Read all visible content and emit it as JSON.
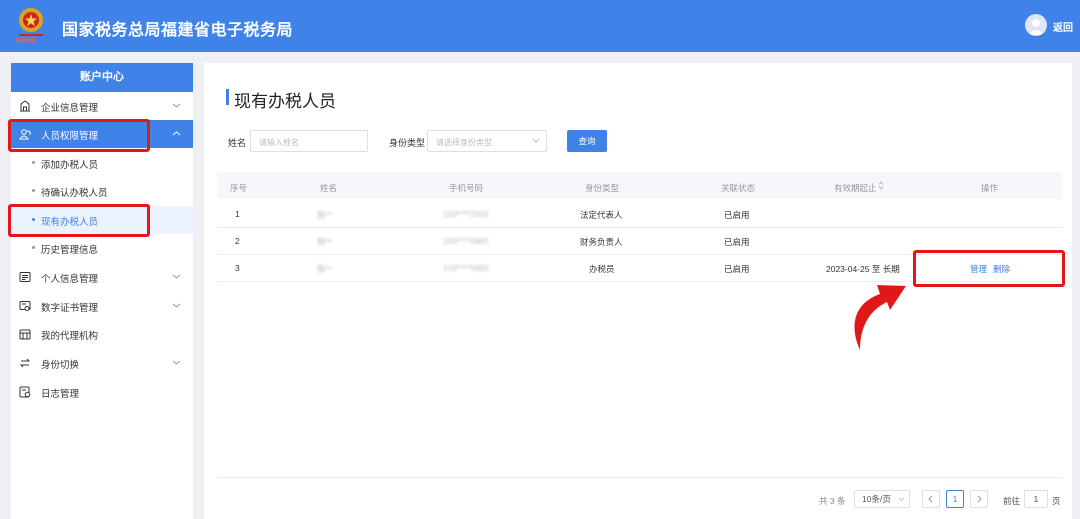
{
  "header": {
    "title": "国家税务总局福建省电子税务局",
    "back_label": "返回",
    "emblem_caption": "中国税务"
  },
  "sidebar": {
    "title": "账户中心",
    "items": [
      {
        "label": "企业信息管理",
        "icon": "building-icon",
        "expandable": true
      },
      {
        "label": "人员权限管理",
        "icon": "users-icon",
        "expandable": true,
        "expanded": true
      },
      {
        "label": "个人信息管理",
        "icon": "profile-card-icon",
        "expandable": true
      },
      {
        "label": "数字证书管理",
        "icon": "certificate-icon",
        "expandable": true
      },
      {
        "label": "我的代理机构",
        "icon": "agency-icon",
        "expandable": false
      },
      {
        "label": "身份切换",
        "icon": "switch-icon",
        "expandable": true
      },
      {
        "label": "日志管理",
        "icon": "log-icon",
        "expandable": false
      }
    ],
    "sub_items": [
      {
        "label": "添加办税人员"
      },
      {
        "label": "待确认办税人员"
      },
      {
        "label": "现有办税人员",
        "selected": true
      },
      {
        "label": "历史管理信息"
      }
    ]
  },
  "page": {
    "title": "现有办税人员"
  },
  "filters": {
    "name_label": "姓名",
    "name_placeholder": "请输入姓名",
    "id_type_label": "身份类型",
    "id_type_placeholder": "请选择身份类型",
    "query_label": "查询"
  },
  "table": {
    "headers": [
      "序号",
      "姓名",
      "手机号码",
      "身份类型",
      "关联状态",
      "有效期起止",
      "操作"
    ],
    "rows": [
      {
        "no": "1",
        "name": "陈**",
        "phone": "159****2601",
        "type": "法定代表人",
        "status": "已启用",
        "validity": ""
      },
      {
        "no": "2",
        "name": "郑**",
        "phone": "159****0881",
        "type": "财务负责人",
        "status": "已启用",
        "validity": ""
      },
      {
        "no": "3",
        "name": "陈**",
        "phone": "159****5891",
        "type": "办税员",
        "status": "已启用",
        "validity": "2023-04-25 至 长期",
        "actions": [
          "管理",
          "删除"
        ]
      }
    ]
  },
  "pagination": {
    "total_text": "共 3 条",
    "page_size": "10条/页",
    "current_page": "1",
    "goto_label": "前往",
    "goto_value": "1",
    "page_unit": "页"
  },
  "colors": {
    "brand_blue": "#3f82e8",
    "highlight_red": "#e21818"
  }
}
